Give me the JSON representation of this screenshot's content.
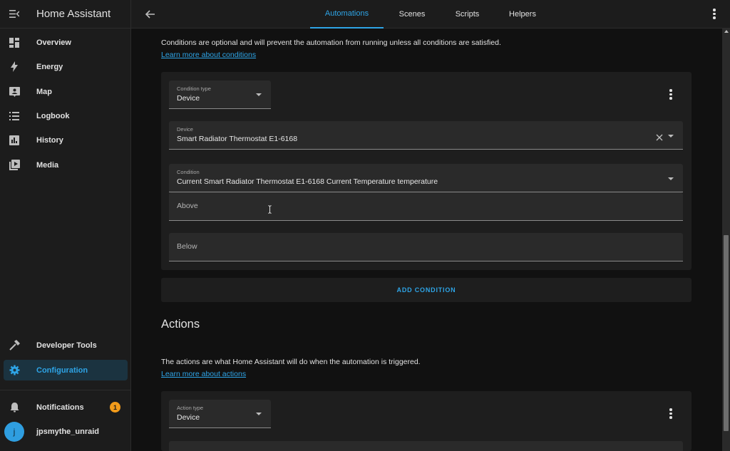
{
  "app": {
    "title": "Home Assistant"
  },
  "sidebar": {
    "items": [
      {
        "label": "Overview",
        "icon": "dashboard-icon"
      },
      {
        "label": "Energy",
        "icon": "lightning-icon"
      },
      {
        "label": "Map",
        "icon": "map-icon"
      },
      {
        "label": "Logbook",
        "icon": "list-icon"
      },
      {
        "label": "History",
        "icon": "chart-icon"
      },
      {
        "label": "Media",
        "icon": "media-icon"
      }
    ],
    "bottom_items": [
      {
        "label": "Developer Tools",
        "icon": "hammer-icon"
      },
      {
        "label": "Configuration",
        "icon": "gear-icon"
      }
    ],
    "notifications": {
      "label": "Notifications",
      "count": "1"
    },
    "user": {
      "name": "jpsmythe_unraid",
      "initial": "j"
    }
  },
  "topbar": {
    "tabs": [
      "Automations",
      "Scenes",
      "Scripts",
      "Helpers"
    ],
    "active_tab": "Automations"
  },
  "conditions": {
    "description": "Conditions are optional and will prevent the automation from running unless all conditions are satisfied.",
    "learn_more": "Learn more about conditions",
    "condition_type_label": "Condition type",
    "condition_type_value": "Device",
    "device_label": "Device",
    "device_value": "Smart Radiator Thermostat E1-6168",
    "condition_label": "Condition",
    "condition_value": "Current Smart Radiator Thermostat E1-6168 Current Temperature temperature",
    "above_placeholder": "Above",
    "below_placeholder": "Below",
    "add_button": "ADD CONDITION"
  },
  "actions": {
    "title": "Actions",
    "description": "The actions are what Home Assistant will do when the automation is triggered.",
    "learn_more": "Learn more about actions",
    "action_type_label": "Action type",
    "action_type_value": "Device"
  },
  "colors": {
    "accent": "#2ea4e6",
    "badge": "#f29b1a",
    "background": "#111111",
    "card": "#1e1e1e"
  }
}
